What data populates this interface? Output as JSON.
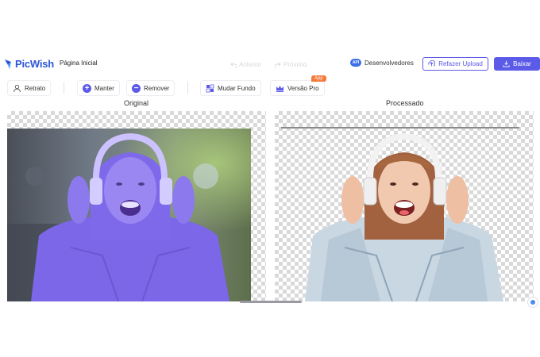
{
  "header": {
    "brand": "PicWish",
    "home": "Página Inicial",
    "undo": "Anterior",
    "redo": "Próximo",
    "developers": "Desenvolvedores",
    "developers_badge": "API",
    "reupload": "Refazer Upload",
    "download": "Baixar"
  },
  "toolbar": {
    "portrait": "Retrato",
    "keep": "Manter",
    "remove": "Remover",
    "change_bg": "Mudar Fundo",
    "pro": "Versão Pro",
    "app_badge": "App"
  },
  "panels": {
    "original_label": "Original",
    "processed_label": "Processado"
  },
  "colors": {
    "accent": "#5b5be8",
    "brand": "#2c56d8",
    "selection_overlay": "#8a72ff",
    "badge": "#f47a3b"
  }
}
